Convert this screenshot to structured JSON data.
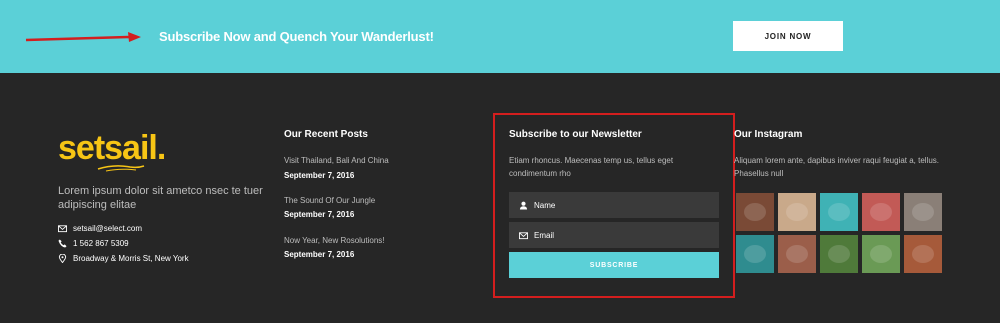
{
  "top_banner": {
    "text": "Subscribe Now and Quench Your Wanderlust!",
    "button_label": "JOIN NOW"
  },
  "brand": {
    "logo_text": "setsail.",
    "description": "Lorem ipsum dolor sit ametco nsec te tuer adipiscing elitae",
    "contacts": [
      {
        "icon": "envelope-icon",
        "text": "setsail@select.com"
      },
      {
        "icon": "phone-icon",
        "text": "1 562 867 5309"
      },
      {
        "icon": "map-pin-icon",
        "text": "Broadway & Morris St, New York"
      }
    ]
  },
  "recent_posts": {
    "title": "Our Recent Posts",
    "posts": [
      {
        "title": "Visit Thailand, Bali And China",
        "date": "September 7, 2016"
      },
      {
        "title": "The Sound Of Our Jungle",
        "date": "September 7, 2016"
      },
      {
        "title": "Now Year, New Rosolutions!",
        "date": "September 7, 2016"
      }
    ]
  },
  "newsletter": {
    "title": "Subscribe to our Newsletter",
    "description": "Etiam rhoncus. Maecenas temp us, tellus eget condimentum rho",
    "name_placeholder": "Name",
    "email_placeholder": "Email",
    "button_label": "SUBSCRIBE"
  },
  "instagram": {
    "title": "Our Instagram",
    "description": "Aliquam lorem ante, dapibus inviver raqui feugiat a, tellus. Phasellus null",
    "tile_colors": [
      "#7a4a36",
      "#c9a98a",
      "#3fb2b5",
      "#c25a56",
      "#8a7f77",
      "#2f8c8f",
      "#9b5e4a",
      "#4f7a3a",
      "#6a9a55",
      "#a65a3a"
    ]
  },
  "colors": {
    "accent": "#5bd0d7",
    "footer_bg": "#262626",
    "logo": "#f7c515",
    "highlight_border": "#d31e1e"
  }
}
